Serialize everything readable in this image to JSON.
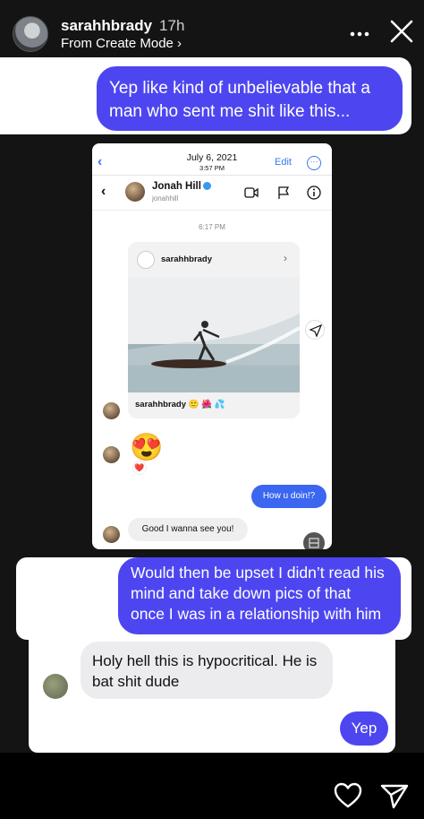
{
  "header": {
    "username": "sarahhbrady",
    "time_ago": "17h",
    "subtitle": "From Create Mode ›"
  },
  "messages": {
    "top": "Yep like kind of unbelievable that a man who sent me shit like this...",
    "middle": "Would then be upset I didn’t read his mind and take down pics of that once I was in a relationship with him",
    "reply": "Holy hell this is hypocritical. He is bat shit dude",
    "yep": "Yep"
  },
  "embedded": {
    "date": "July 6, 2021",
    "time": "3:57 PM",
    "edit": "Edit",
    "contact_name": "Jonah Hill",
    "contact_handle": "jonahhill",
    "timestamp": "6:17 PM",
    "post_user": "sarahhbrady",
    "post_caption": "sarahhbrady 🙂 🌺 💦",
    "emoji": "😍",
    "heart_reaction": "❤️",
    "sent_message": "How u doin!?",
    "received_message": "Good I wanna see you!"
  },
  "colors": {
    "bubble_blue": "#4d46f0",
    "ig_blue": "#3478f6"
  },
  "icons": [
    "more-icon",
    "close-icon",
    "video-icon",
    "flag-icon",
    "info-icon",
    "heart-icon",
    "send-icon"
  ]
}
